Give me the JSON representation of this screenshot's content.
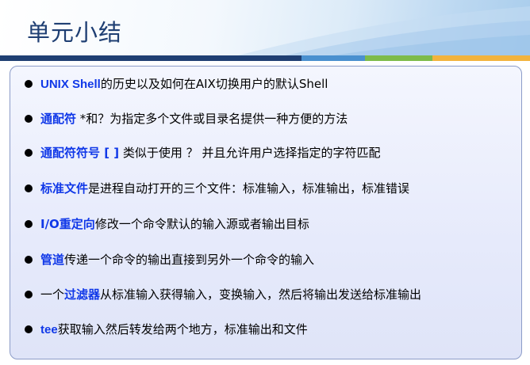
{
  "slide": {
    "title": "单元小结"
  },
  "bullets": [
    {
      "keyword": "UNIX Shell",
      "text": "的历史以及如何在AIX切换用户的默认Shell"
    },
    {
      "keyword": "通配符",
      "text": " *和？为指定多个文件或目录名提供一种方便的方法"
    },
    {
      "keyword": "通配符符号 [ ]",
      "text": " 类似于使用 ？ 并且允许用户选择指定的字符匹配"
    },
    {
      "keyword": "标准文件",
      "text": "是进程自动打开的三个文件：标准输入，标准输出，标准错误"
    },
    {
      "keyword": "I/O重定向",
      "text": "修改一个命令默认的输入源或者输出目标"
    },
    {
      "keyword": "管道",
      "text": "传递一个命令的输出直接到另外一个命令的输入"
    },
    {
      "prefix": "一个",
      "keyword": "过滤器",
      "text": "从标准输入获得输入，变换输入，然后将输出发送给标准输出"
    },
    {
      "keyword": "tee",
      "text": "获取输入然后转发给两个地方，标准输出和文件"
    }
  ],
  "colors": {
    "title": "#1f3f73",
    "keyword": "#1038e8",
    "bar_navy": "#1f3f73",
    "bar_blue": "#4a90cf",
    "bar_green": "#7dbb4a",
    "bar_yellow": "#f2b33d",
    "box_border": "#8c9cc8"
  }
}
